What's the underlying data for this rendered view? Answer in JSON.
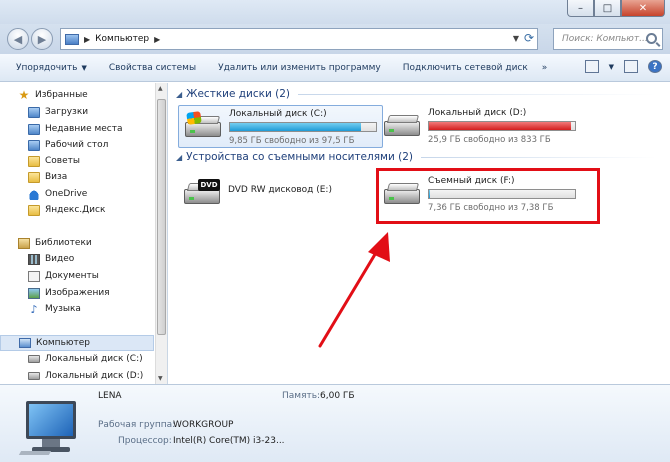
{
  "window": {
    "min": "–",
    "max": "□",
    "close": "✕"
  },
  "nav": {
    "back": "◀",
    "forward": "▶",
    "address": "Компьютер",
    "search_placeholder": "Поиск: Компьют..."
  },
  "toolbar": {
    "organize": "Упорядочить",
    "system_props": "Свойства системы",
    "uninstall": "Удалить или изменить программу",
    "map_drive": "Подключить сетевой диск",
    "more": "»"
  },
  "sidebar": {
    "favorites": "Избранные",
    "fav_items": [
      "Загрузки",
      "Недавние места",
      "Рабочий стол",
      "Советы",
      "Виза",
      "OneDrive",
      "Яндекс.Диск"
    ],
    "libraries": "Библиотеки",
    "lib_items": [
      "Видео",
      "Документы",
      "Изображения",
      "Музыка"
    ],
    "computer": "Компьютер",
    "comp_items": [
      "Локальный диск (C:)",
      "Локальный диск (D:)"
    ]
  },
  "content": {
    "hdd_group": "Жесткие диски (2)",
    "removable_group": "Устройства со съемными носителями (2)",
    "drives": {
      "c": {
        "name": "Локальный диск (C:)",
        "free": "9,85 ГБ свободно из 97,5 ГБ",
        "used_fraction": 0.9
      },
      "d": {
        "name": "Локальный диск (D:)",
        "free": "25,9 ГБ свободно из 833 ГБ",
        "used_fraction": 0.97
      },
      "e": {
        "name": "DVD RW дисковод (E:)",
        "label": "DVD"
      },
      "f": {
        "name": "Съемный диск (F:)",
        "free": "7,36 ГБ свободно из 7,38 ГБ",
        "used_fraction": 0.003
      }
    }
  },
  "details": {
    "name": "LENA",
    "memory_label": "Память:",
    "memory": "6,00 ГБ",
    "workgroup_label": "Рабочая группа:",
    "workgroup": "WORKGROUP",
    "cpu_label": "Процессор:",
    "cpu": "Intel(R) Core(TM) i3-23..."
  },
  "colors": {
    "highlight": "#e20e16",
    "group_title": "#1e3f7a",
    "bar_blue": "#1e9bd6",
    "bar_red": "#d31e1e"
  }
}
